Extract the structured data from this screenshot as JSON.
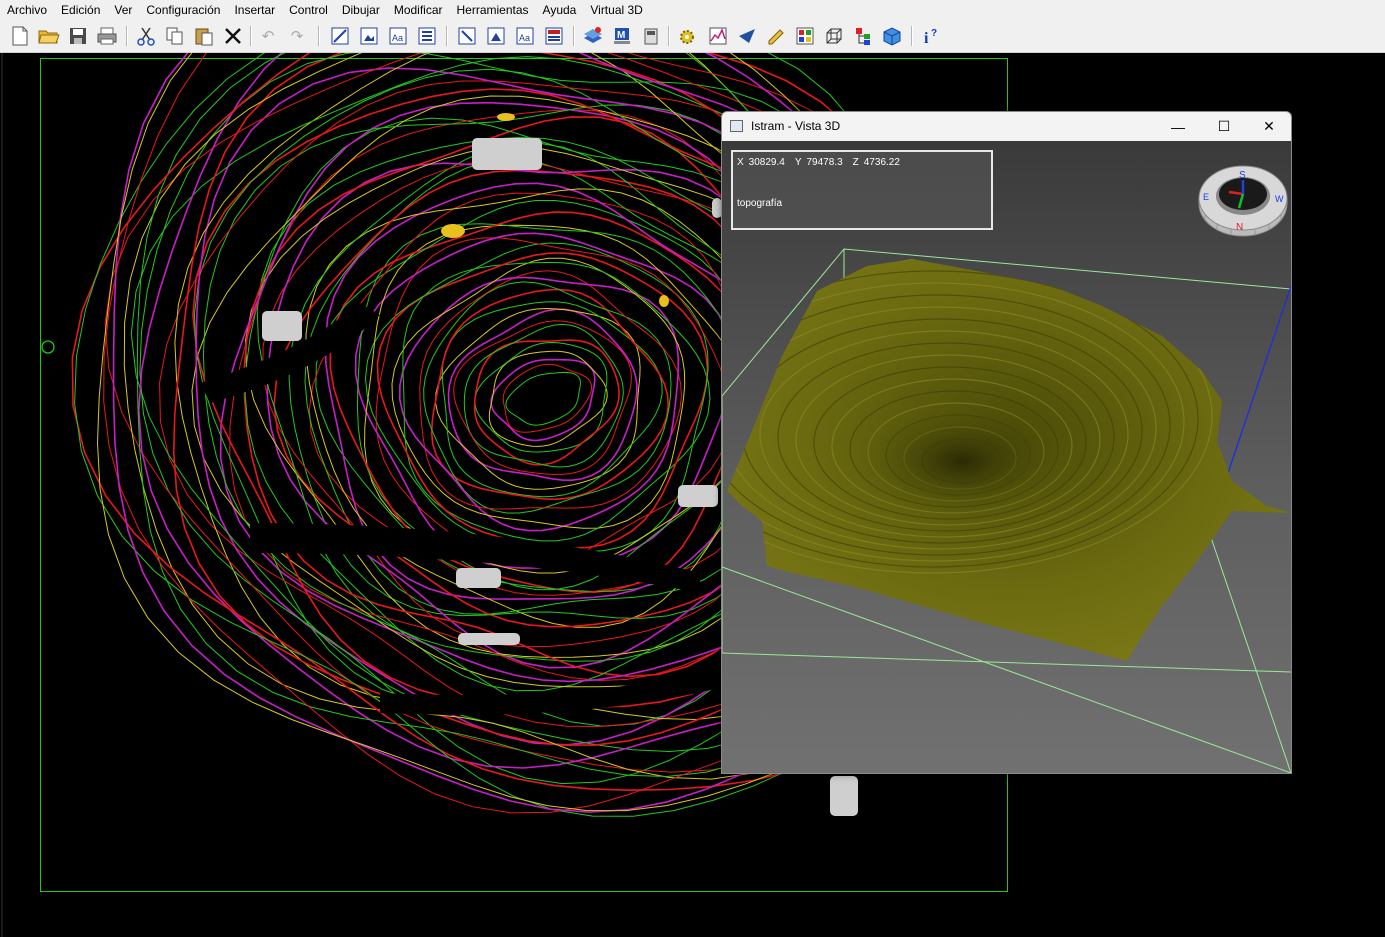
{
  "menu": [
    "Archivo",
    "Edición",
    "Ver",
    "Configuración",
    "Insertar",
    "Control",
    "Dibujar",
    "Modificar",
    "Herramientas",
    "Ayuda",
    "Virtual 3D"
  ],
  "toolbar": {
    "icons": [
      "new-file-icon",
      "open-folder-icon",
      "save-icon",
      "print-icon",
      "cut-icon",
      "copy-icon",
      "paste-icon",
      "delete-icon",
      "undo-icon",
      "redo-icon",
      "zoom-window-icon",
      "zoom-extents-icon",
      "zoom-text-icon",
      "zoom-list-icon",
      "pan-icon",
      "view-frame-icon",
      "text-frame-icon",
      "layout-icon",
      "layers-3d-icon",
      "model-icon",
      "camera-icon",
      "settings-gear-icon",
      "profile-chart-icon",
      "arrow-icon",
      "pencil-icon",
      "palette-icon",
      "wireframe-cube-icon",
      "tree-hierarchy-icon",
      "solid-cube-icon",
      "help-icon"
    ]
  },
  "colors": {
    "contour_green": "#22c81e",
    "contour_red": "#e8181e",
    "contour_magenta": "#c81ec8",
    "contour_yellow": "#d8c81e",
    "terrain_olive": "#6b6a10",
    "frame_green": "#4ce04c",
    "axis_blue": "#1e2ee0"
  },
  "window3d": {
    "title": "Istram - Vista 3D",
    "minimize_symbol": "—",
    "maximize_symbol": "☐",
    "close_symbol": "✕",
    "info": {
      "x_label": "X",
      "x_value": "30829.4",
      "y_label": "Y",
      "y_value": "79478.3",
      "z_label": "Z",
      "z_value": "4736.22",
      "layer": "topografía"
    },
    "compass_letters": [
      "S",
      "E",
      "N",
      "W"
    ]
  }
}
